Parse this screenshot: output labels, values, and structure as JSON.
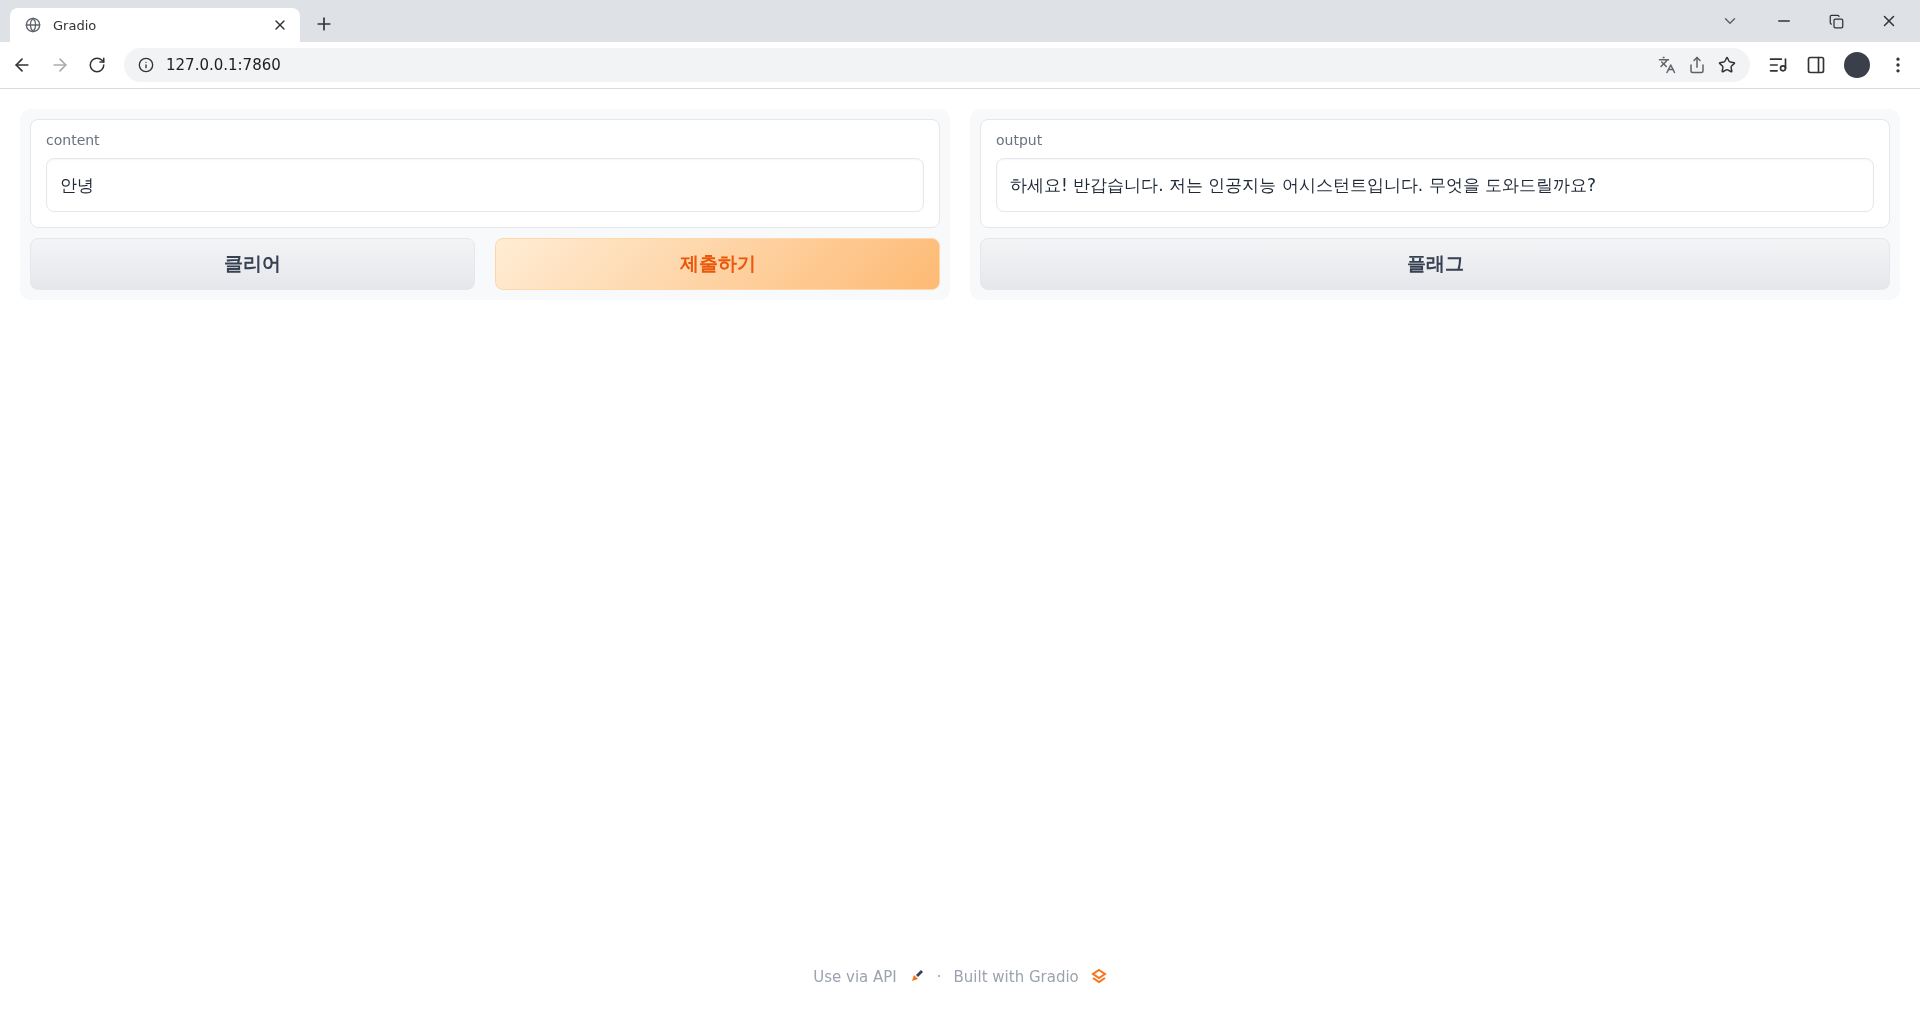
{
  "browser": {
    "tab": {
      "title": "Gradio",
      "selected": true
    },
    "address": "127.0.0.1:7860"
  },
  "panels": [
    {
      "field": {
        "label": "content",
        "value": "안녕"
      },
      "buttons": [
        {
          "label": "클리어",
          "kind": "secondary"
        },
        {
          "label": "제출하기",
          "kind": "primary"
        }
      ]
    },
    {
      "field": {
        "label": "output",
        "value": "하세요! 반갑습니다. 저는 인공지능 어시스턴트입니다. 무엇을 도와드릴까요?"
      },
      "buttons": [
        {
          "label": "플래그",
          "kind": "secondary"
        }
      ]
    }
  ],
  "footer": {
    "api_link": "Use via API",
    "separator": "·",
    "built_with": "Built with Gradio"
  }
}
